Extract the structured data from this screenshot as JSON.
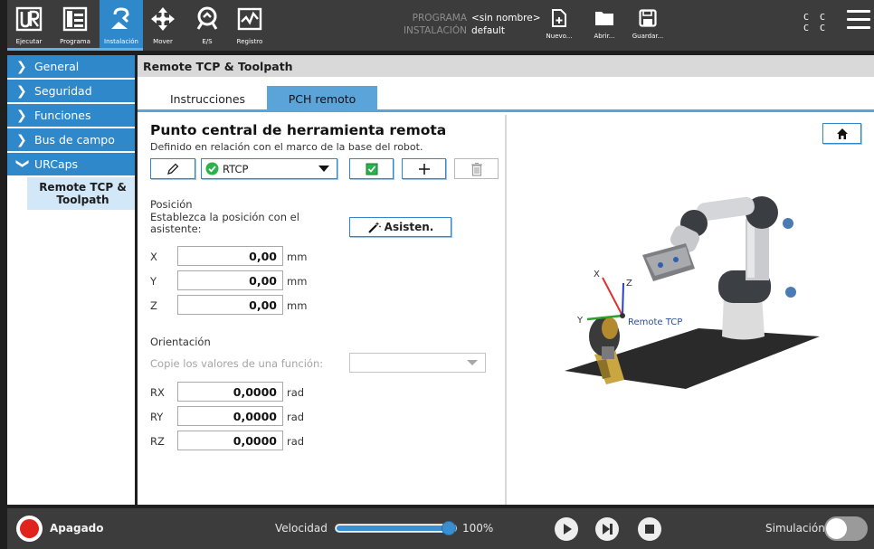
{
  "topbar": {
    "nav": [
      {
        "label": "Ejecutar",
        "icon": "ur-logo-icon"
      },
      {
        "label": "Programa",
        "icon": "program-tree-icon"
      },
      {
        "label": "Instalación",
        "icon": "installation-icon",
        "active": true
      },
      {
        "label": "Mover",
        "icon": "move-arrows-icon"
      },
      {
        "label": "E/S",
        "icon": "io-icon"
      },
      {
        "label": "Registro",
        "icon": "log-chart-icon"
      }
    ],
    "program_key": "PROGRAMA",
    "program_value": "<sin nombre>",
    "installation_key": "INSTALACIÓN",
    "installation_value": "default",
    "file_buttons": [
      {
        "label": "Nuevo...",
        "icon": "new-file-icon"
      },
      {
        "label": "Abrir...",
        "icon": "folder-icon"
      },
      {
        "label": "Guardar...",
        "icon": "save-icon"
      }
    ],
    "cc_top": "C C",
    "cc_bottom": "C C"
  },
  "sidebar": {
    "items": [
      {
        "label": "General",
        "expanded": false
      },
      {
        "label": "Seguridad",
        "expanded": false
      },
      {
        "label": "Funciones",
        "expanded": false
      },
      {
        "label": "Bus de campo",
        "expanded": false
      },
      {
        "label": "URCaps",
        "expanded": true
      }
    ],
    "sub_item": "Remote TCP & Toolpath"
  },
  "main": {
    "title": "Remote TCP & Toolpath",
    "tabs": [
      {
        "label": "Instrucciones",
        "active": false
      },
      {
        "label": "PCH remoto",
        "active": true
      }
    ],
    "heading": "Punto central de herramienta remota",
    "subheading": "Definido en relación con el marco de la base del robot.",
    "tcp_select": "RTCP",
    "position": {
      "title": "Posición",
      "wizard_text": "Establezca la posición con el asistente:",
      "wizard_button": "Asisten.",
      "rows": [
        {
          "axis": "X",
          "value": "0,00",
          "unit": "mm"
        },
        {
          "axis": "Y",
          "value": "0,00",
          "unit": "mm"
        },
        {
          "axis": "Z",
          "value": "0,00",
          "unit": "mm"
        }
      ]
    },
    "orientation": {
      "title": "Orientación",
      "copy_label": "Copie los valores de una función:",
      "copy_value": "",
      "rows": [
        {
          "axis": "RX",
          "value": "0,0000",
          "unit": "rad"
        },
        {
          "axis": "RY",
          "value": "0,0000",
          "unit": "rad"
        },
        {
          "axis": "RZ",
          "value": "0,0000",
          "unit": "rad"
        }
      ]
    },
    "viewer": {
      "tcp_label": "Remote TCP",
      "axis_x": "X",
      "axis_y": "Y",
      "axis_z": "Z"
    }
  },
  "bottombar": {
    "power_status": "Apagado",
    "speed_label": "Velocidad",
    "speed_value": "100%",
    "speed_fraction": 1.0,
    "simulation_label": "Simulación",
    "simulation_on": false
  },
  "colors": {
    "accent": "#2f88c9",
    "topbar_bg": "#3c3c3c",
    "power_red": "#e0231c",
    "check_green": "#2bb24c"
  }
}
